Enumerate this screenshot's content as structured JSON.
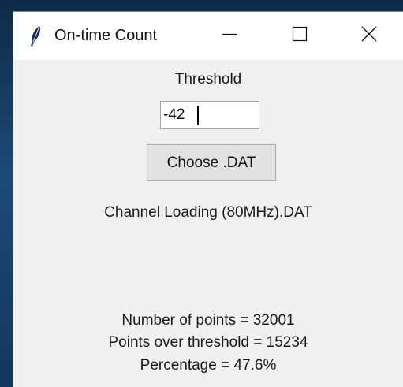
{
  "window": {
    "title": "On-time Count",
    "icon": "feather-icon"
  },
  "controls": {
    "minimize_icon": "minimize-icon",
    "maximize_icon": "maximize-icon",
    "close_icon": "close-icon"
  },
  "form": {
    "threshold_label": "Threshold",
    "threshold_value": "-42",
    "choose_button_label": "Choose .DAT"
  },
  "results": {
    "filename": "Channel Loading (80MHz).DAT",
    "number_of_points": "Number of points = 32001",
    "points_over_threshold": "Points over threshold = 15234",
    "percentage": "Percentage = 47.6%"
  },
  "colors": {
    "window_bg": "#f0f0f0",
    "titlebar_bg": "#ffffff",
    "button_bg": "#e1e1e1",
    "desktop_bg": "#16365a"
  }
}
